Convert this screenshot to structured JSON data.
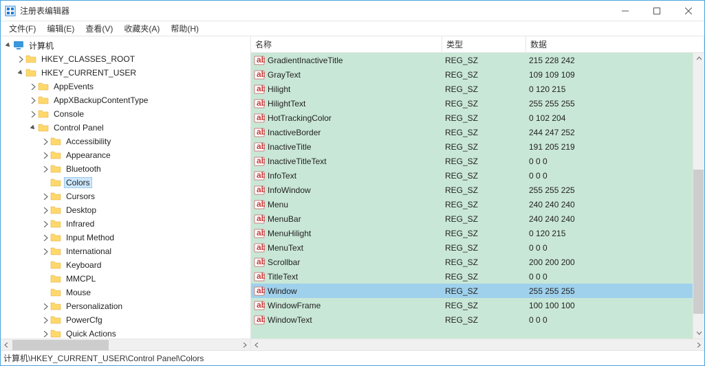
{
  "window": {
    "title": "注册表编辑器"
  },
  "menu": [
    "文件(F)",
    "编辑(E)",
    "查看(V)",
    "收藏夹(A)",
    "帮助(H)"
  ],
  "tree": {
    "root": "计算机",
    "hives": [
      {
        "label": "HKEY_CLASSES_ROOT",
        "expanded": false,
        "hasChildren": true
      },
      {
        "label": "HKEY_CURRENT_USER",
        "expanded": true,
        "hasChildren": true,
        "children": [
          {
            "label": "AppEvents",
            "hasChildren": true
          },
          {
            "label": "AppXBackupContentType",
            "hasChildren": true
          },
          {
            "label": "Console",
            "hasChildren": true
          },
          {
            "label": "Control Panel",
            "expanded": true,
            "hasChildren": true,
            "children": [
              {
                "label": "Accessibility",
                "hasChildren": true
              },
              {
                "label": "Appearance",
                "hasChildren": true
              },
              {
                "label": "Bluetooth",
                "hasChildren": true
              },
              {
                "label": "Colors",
                "selected": true,
                "hasChildren": false
              },
              {
                "label": "Cursors",
                "hasChildren": true
              },
              {
                "label": "Desktop",
                "hasChildren": true
              },
              {
                "label": "Infrared",
                "hasChildren": true
              },
              {
                "label": "Input Method",
                "hasChildren": true
              },
              {
                "label": "International",
                "hasChildren": true
              },
              {
                "label": "Keyboard",
                "hasChildren": false
              },
              {
                "label": "MMCPL",
                "hasChildren": false
              },
              {
                "label": "Mouse",
                "hasChildren": false
              },
              {
                "label": "Personalization",
                "hasChildren": true
              },
              {
                "label": "PowerCfg",
                "hasChildren": true
              },
              {
                "label": "Quick Actions",
                "hasChildren": true
              }
            ]
          }
        ]
      }
    ]
  },
  "list": {
    "columns": {
      "name": "名称",
      "type": "类型",
      "data": "数据"
    },
    "rows": [
      {
        "name": "GradientInactiveTitle",
        "type": "REG_SZ",
        "data": "215 228 242"
      },
      {
        "name": "GrayText",
        "type": "REG_SZ",
        "data": "109 109 109"
      },
      {
        "name": "Hilight",
        "type": "REG_SZ",
        "data": "0 120 215"
      },
      {
        "name": "HilightText",
        "type": "REG_SZ",
        "data": "255 255 255"
      },
      {
        "name": "HotTrackingColor",
        "type": "REG_SZ",
        "data": "0 102 204"
      },
      {
        "name": "InactiveBorder",
        "type": "REG_SZ",
        "data": "244 247 252"
      },
      {
        "name": "InactiveTitle",
        "type": "REG_SZ",
        "data": "191 205 219"
      },
      {
        "name": "InactiveTitleText",
        "type": "REG_SZ",
        "data": "0 0 0"
      },
      {
        "name": "InfoText",
        "type": "REG_SZ",
        "data": "0 0 0"
      },
      {
        "name": "InfoWindow",
        "type": "REG_SZ",
        "data": "255 255 225"
      },
      {
        "name": "Menu",
        "type": "REG_SZ",
        "data": "240 240 240"
      },
      {
        "name": "MenuBar",
        "type": "REG_SZ",
        "data": "240 240 240"
      },
      {
        "name": "MenuHilight",
        "type": "REG_SZ",
        "data": "0 120 215"
      },
      {
        "name": "MenuText",
        "type": "REG_SZ",
        "data": "0 0 0"
      },
      {
        "name": "Scrollbar",
        "type": "REG_SZ",
        "data": "200 200 200"
      },
      {
        "name": "TitleText",
        "type": "REG_SZ",
        "data": "0 0 0"
      },
      {
        "name": "Window",
        "type": "REG_SZ",
        "data": "255 255 255",
        "selected": true
      },
      {
        "name": "WindowFrame",
        "type": "REG_SZ",
        "data": "100 100 100"
      },
      {
        "name": "WindowText",
        "type": "REG_SZ",
        "data": "0 0 0"
      }
    ]
  },
  "status": {
    "path": "计算机\\HKEY_CURRENT_USER\\Control Panel\\Colors"
  }
}
